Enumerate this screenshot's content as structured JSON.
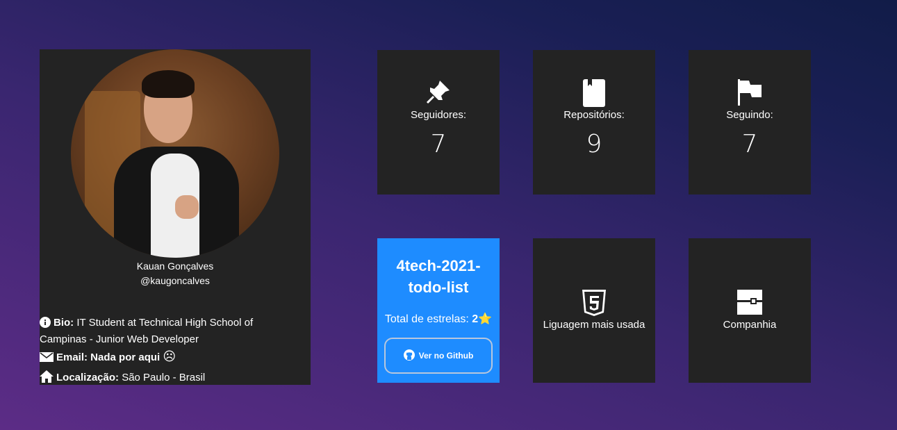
{
  "profile": {
    "name": "Kauan Gonçalves",
    "handle": "@kaugoncalves",
    "bio_label": "Bio:",
    "bio_text": " IT Student at Technical High School of Campinas - Junior Web Developer",
    "email_label": "Email: Nada por aqui",
    "email_emoji": "☹",
    "location_label": "Localização:",
    "location_text": " São Paulo - Brasil"
  },
  "stats": [
    {
      "label": "Seguidores:",
      "value": "7",
      "icon": "pin-icon"
    },
    {
      "label": "Repositórios:",
      "value": "9",
      "icon": "book-icon"
    },
    {
      "label": "Seguindo:",
      "value": "7",
      "icon": "flag-icon"
    }
  ],
  "repo": {
    "name": "4tech-2021-todo-list",
    "stars_label": "Total de estrelas:",
    "stars_value": "2",
    "star_icon": "⭐",
    "button_label": "Ver no Github"
  },
  "language": {
    "label": "Liguagem mais usada",
    "icon": "html5-icon"
  },
  "company": {
    "label": "Companhia",
    "icon": "company-icon"
  },
  "colors": {
    "card_bg": "#232323",
    "repo_bg": "#1e8cff"
  }
}
